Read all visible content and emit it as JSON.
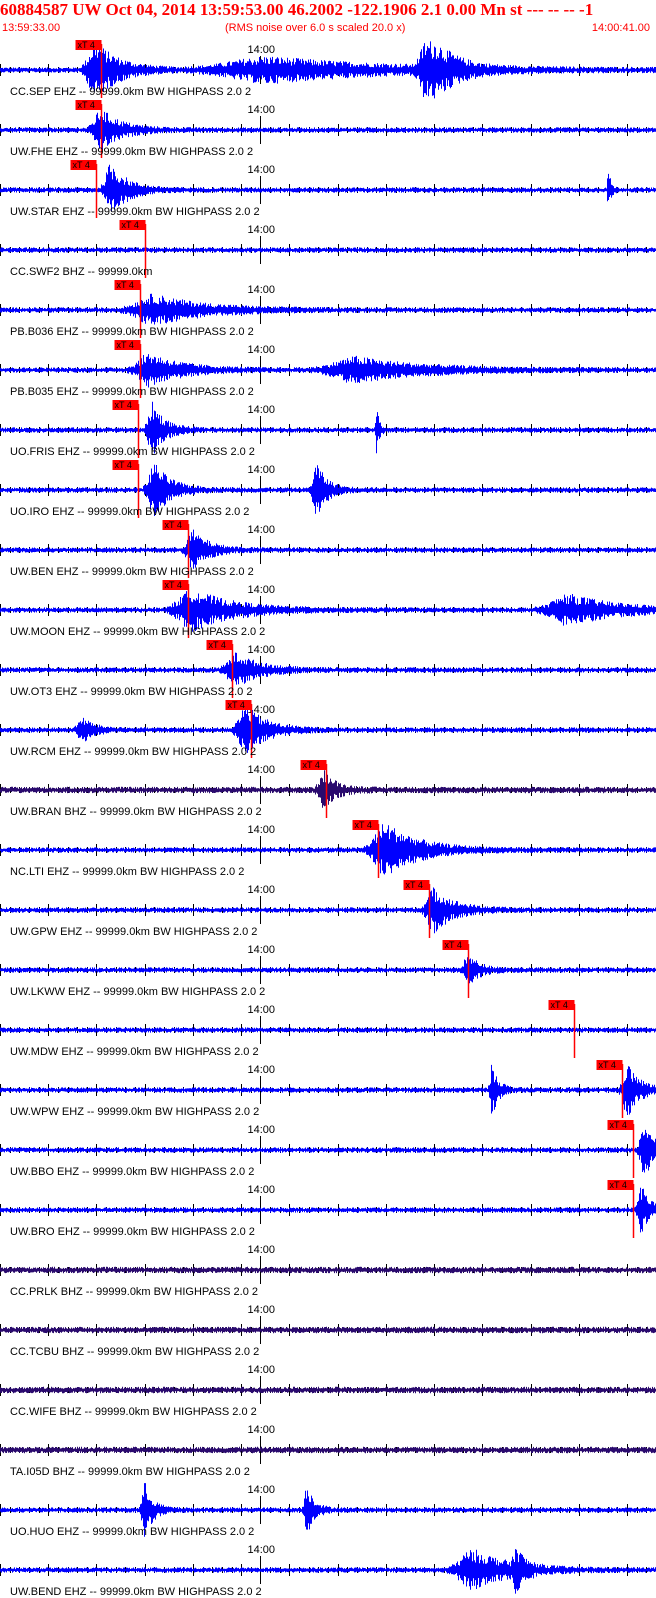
{
  "header": {
    "title": "60884587 UW Oct 04, 2014 13:59:53.00   46.2002 -122.1906  2.1 0.00 Mn st --- -- --  -1",
    "start_time": "13:59:33.00",
    "noise_note": "(RMS noise over 6.0 s scaled 20.0 x)",
    "end_time": "14:00:41.00"
  },
  "colors": {
    "trace": "#0000ff",
    "trace_dark": "#2a0a6e",
    "pick": "#ff0000",
    "axis": "#000000",
    "header_text": "#ff0000"
  },
  "chart_data": {
    "type": "line",
    "time_start": "13:59:33.00",
    "time_end": "14:00:41.00",
    "duration_s": 68,
    "minute_tick_label": "14:00",
    "minute_tick_offset_s": 27,
    "pick_label": "xT 4",
    "traces": [
      {
        "label": "CC.SEP EHZ -- 99999.0km BW  HIGHPASS  2.0  2",
        "pick_s": 10.5,
        "color": "blue",
        "bursts": [
          [
            10,
            3.0,
            1.0
          ],
          [
            44.5,
            2.8,
            1.3
          ],
          [
            28,
            15,
            0.45
          ]
        ]
      },
      {
        "label": "UW.FHE EHZ -- 99999.0km BW  HIGHPASS  2.0  2",
        "pick_s": 10.5,
        "color": "blue",
        "bursts": [
          [
            10.5,
            2.5,
            0.75
          ]
        ]
      },
      {
        "label": "UW.STAR EHZ -- 99999.0km BW  HIGHPASS  2.0  2",
        "pick_s": 10.0,
        "color": "blue",
        "bursts": [
          [
            11.5,
            2.0,
            1.0
          ],
          [
            63,
            0.3,
            0.9
          ]
        ]
      },
      {
        "label": "CC.SWF2 BHZ -- 99999.0km",
        "pick_s": 15.0,
        "color": "blue",
        "bursts": []
      },
      {
        "label": "PB.B036 EHZ -- 99999.0km BW  HIGHPASS  2.0  2",
        "pick_s": 14.5,
        "color": "blue",
        "bursts": [
          [
            16,
            6.0,
            0.55
          ]
        ]
      },
      {
        "label": "PB.B035 EHZ -- 99999.0km BW  HIGHPASS  2.0  2",
        "pick_s": 14.5,
        "color": "blue",
        "bursts": [
          [
            15.5,
            4.0,
            0.6
          ],
          [
            37,
            8.0,
            0.45
          ]
        ]
      },
      {
        "label": "UO.FRIS EHZ -- 99999.0km BW  HIGHPASS  2.0  2",
        "pick_s": 14.3,
        "color": "blue",
        "bursts": [
          [
            15.8,
            1.5,
            1.0
          ],
          [
            39,
            0.3,
            1.0
          ]
        ]
      },
      {
        "label": "UO.IRO EHZ -- 99999.0km BW  HIGHPASS  2.0  2",
        "pick_s": 14.3,
        "color": "blue",
        "bursts": [
          [
            16,
            2.0,
            1.0
          ],
          [
            32.8,
            1.3,
            1.0
          ]
        ]
      },
      {
        "label": "UW.BEN EHZ -- 99999.0km BW  HIGHPASS  2.0  2",
        "pick_s": 19.5,
        "color": "blue",
        "bursts": [
          [
            20,
            2.0,
            0.7
          ]
        ]
      },
      {
        "label": "UW.MOON EHZ -- 99999.0km BW  HIGHPASS  2.0  2",
        "pick_s": 19.5,
        "color": "blue",
        "bursts": [
          [
            20,
            5.0,
            0.75
          ],
          [
            59,
            6.0,
            0.55
          ]
        ]
      },
      {
        "label": "UW.OT3 EHZ -- 99999.0km BW  HIGHPASS  2.0  2",
        "pick_s": 24.0,
        "color": "blue",
        "bursts": [
          [
            24.5,
            3.0,
            0.6
          ]
        ]
      },
      {
        "label": "UW.RCM EHZ -- 99999.0km BW  HIGHPASS  2.0  2",
        "pick_s": 26.0,
        "color": "blue",
        "bursts": [
          [
            25.5,
            2.5,
            0.9
          ],
          [
            8.5,
            1.5,
            0.45
          ]
        ]
      },
      {
        "label": "UW.BRAN BHZ -- 99999.0km BW  HIGHPASS  2.0  2",
        "pick_s": 33.8,
        "color": "dark",
        "bursts": [
          [
            33.5,
            1.5,
            0.7
          ]
        ]
      },
      {
        "label": "NC.LTI EHZ -- 99999.0km BW  HIGHPASS  2.0  2",
        "pick_s": 39.2,
        "color": "blue",
        "bursts": [
          [
            40,
            4.0,
            1.0
          ]
        ]
      },
      {
        "label": "UW.GPW EHZ -- 99999.0km BW  HIGHPASS  2.0  2",
        "pick_s": 44.5,
        "color": "blue",
        "bursts": [
          [
            45,
            2.5,
            0.8
          ]
        ]
      },
      {
        "label": "UW.LKWW EHZ -- 99999.0km BW  HIGHPASS  2.0  2",
        "pick_s": 48.5,
        "color": "blue",
        "bursts": [
          [
            48.5,
            1.5,
            0.55
          ]
        ]
      },
      {
        "label": "UW.MDW EHZ -- 99999.0km BW  HIGHPASS  2.0  2",
        "pick_s": 59.5,
        "color": "blue",
        "bursts": []
      },
      {
        "label": "UW.WPW EHZ -- 99999.0km BW  HIGHPASS  2.0  2",
        "pick_s": 64.5,
        "color": "blue",
        "bursts": [
          [
            51,
            0.8,
            1.0
          ],
          [
            65,
            1.5,
            1.0
          ]
        ]
      },
      {
        "label": "UW.BBO EHZ -- 99999.0km BW  HIGHPASS  2.0  2",
        "pick_s": 65.6,
        "color": "blue",
        "bursts": [
          [
            66.8,
            1.5,
            1.0
          ]
        ]
      },
      {
        "label": "UW.BRO EHZ -- 99999.0km BW  HIGHPASS  2.0  2",
        "pick_s": 65.6,
        "color": "blue",
        "bursts": [
          [
            66.4,
            1.0,
            1.0
          ]
        ]
      },
      {
        "label": "CC.PRLK BHZ -- 99999.0km BW  HIGHPASS  2.0  2",
        "pick_s": null,
        "color": "dark",
        "bursts": []
      },
      {
        "label": "CC.TCBU BHZ -- 99999.0km BW  HIGHPASS  2.0  2",
        "pick_s": null,
        "color": "dark",
        "bursts": []
      },
      {
        "label": "CC.WIFE BHZ -- 99999.0km BW  HIGHPASS  2.0  2",
        "pick_s": null,
        "color": "dark",
        "bursts": []
      },
      {
        "label": "TA.I05D BHZ -- 99999.0km BW  HIGHPASS  2.0  2",
        "pick_s": null,
        "color": "dark",
        "bursts": []
      },
      {
        "label": "UO.HUO EHZ -- 99999.0km BW  HIGHPASS  2.0  2",
        "pick_s": null,
        "color": "blue",
        "bursts": [
          [
            15,
            1.0,
            1.0
          ],
          [
            31.8,
            0.9,
            1.0
          ]
        ]
      },
      {
        "label": "UW.BEND EHZ -- 99999.0km BW  HIGHPASS  2.0  2",
        "pick_s": null,
        "color": "blue",
        "bursts": [
          [
            49,
            4.5,
            0.75
          ],
          [
            53.5,
            1.0,
            0.7
          ]
        ]
      }
    ]
  }
}
